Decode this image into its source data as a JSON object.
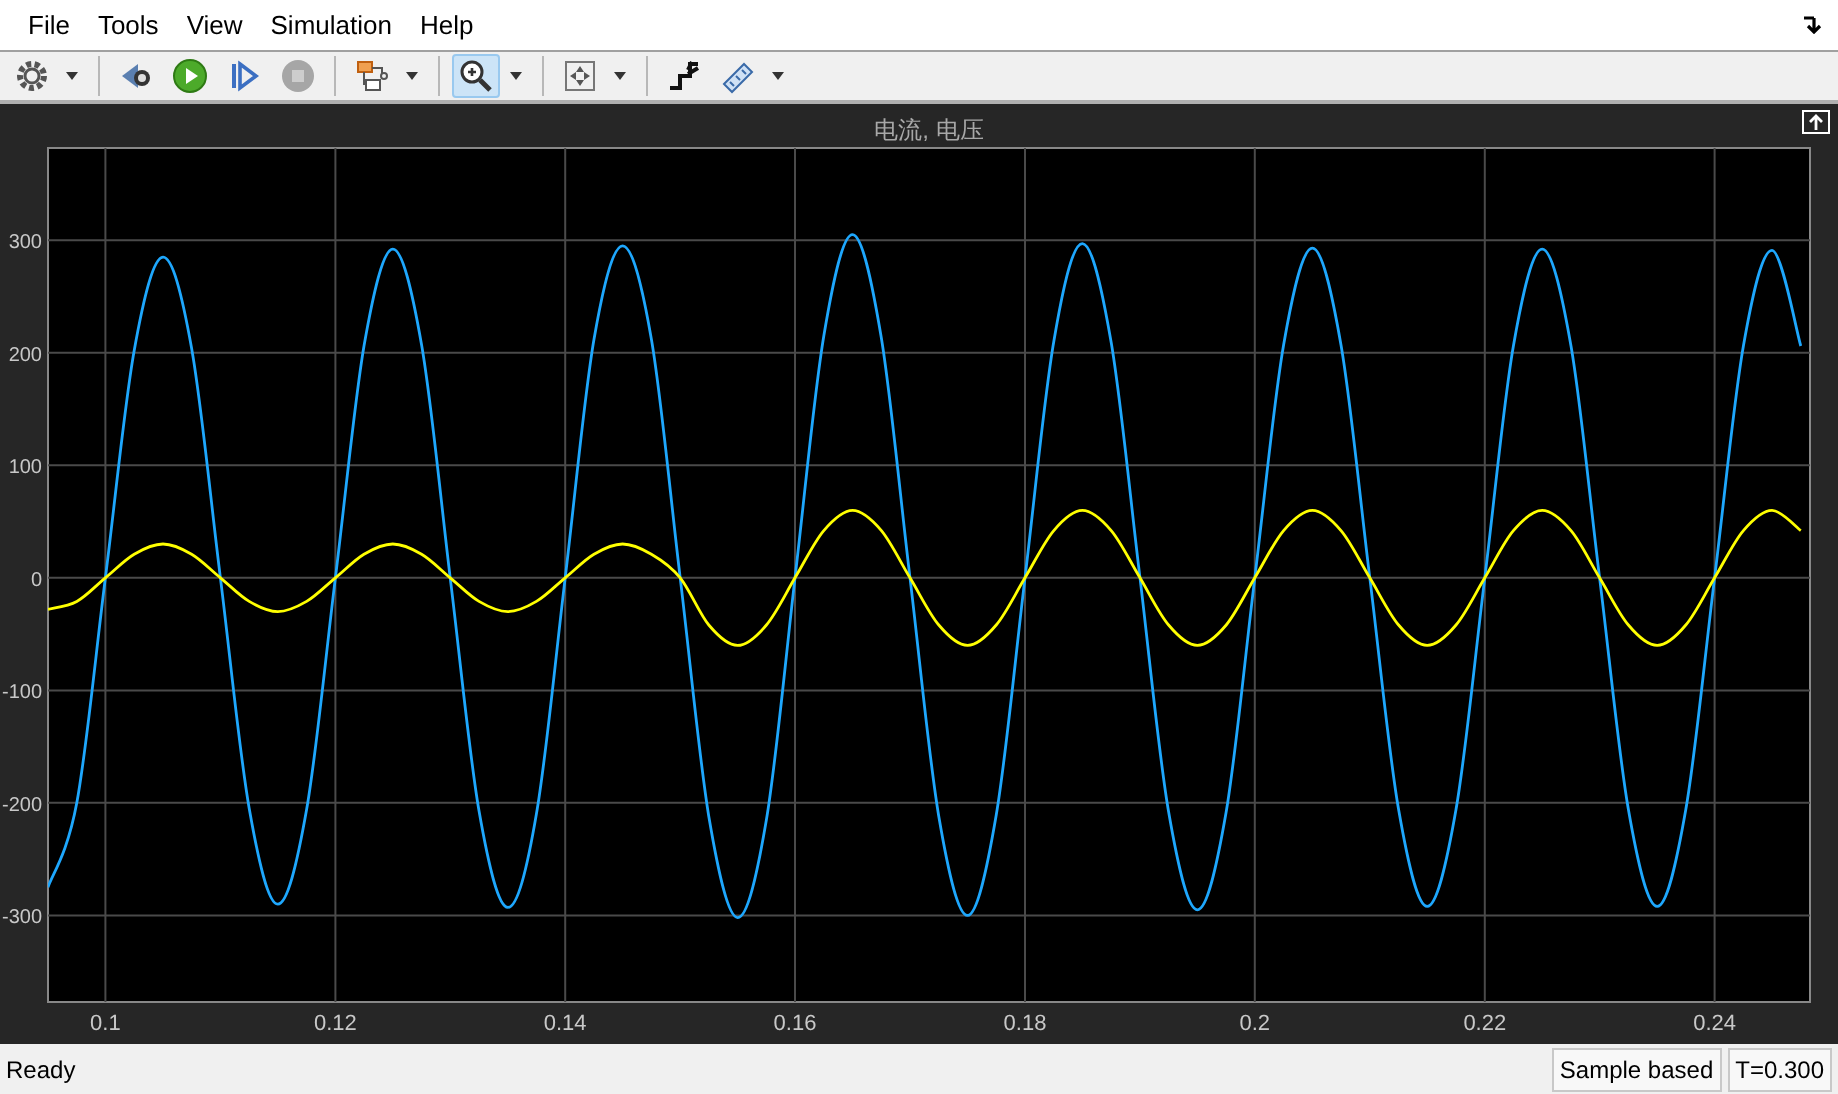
{
  "menu": [
    "File",
    "Tools",
    "View",
    "Simulation",
    "Help"
  ],
  "toolbar": [
    {
      "kind": "settings",
      "dropdown": true,
      "selected": false,
      "disabled": false
    },
    {
      "kind": "separator"
    },
    {
      "kind": "step-back",
      "selected": false,
      "disabled": false
    },
    {
      "kind": "run",
      "selected": false,
      "disabled": false
    },
    {
      "kind": "step-forward",
      "selected": false,
      "disabled": false
    },
    {
      "kind": "stop",
      "selected": false,
      "disabled": true
    },
    {
      "kind": "separator"
    },
    {
      "kind": "highlight",
      "dropdown": true,
      "selected": false,
      "disabled": false
    },
    {
      "kind": "separator"
    },
    {
      "kind": "zoom",
      "dropdown": true,
      "selected": true,
      "disabled": false
    },
    {
      "kind": "separator"
    },
    {
      "kind": "fit",
      "dropdown": true,
      "selected": false,
      "disabled": false
    },
    {
      "kind": "separator"
    },
    {
      "kind": "triggers",
      "selected": false,
      "disabled": false
    },
    {
      "kind": "measure",
      "dropdown": true,
      "selected": false,
      "disabled": false
    }
  ],
  "scope": {
    "chart_data": {
      "type": "line",
      "title": "电流, 电压",
      "x": [
        0.095,
        0.0975,
        0.1,
        0.1025,
        0.105,
        0.1075,
        0.11,
        0.1125,
        0.115,
        0.1175,
        0.12,
        0.1225,
        0.125,
        0.1275,
        0.13,
        0.1325,
        0.135,
        0.1375,
        0.14,
        0.1425,
        0.145,
        0.1475,
        0.15,
        0.1525,
        0.155,
        0.1575,
        0.16,
        0.1625,
        0.165,
        0.1675,
        0.17,
        0.1725,
        0.175,
        0.1775,
        0.18,
        0.1825,
        0.185,
        0.1875,
        0.19,
        0.1925,
        0.195,
        0.1975,
        0.2,
        0.2025,
        0.205,
        0.2075,
        0.21,
        0.2125,
        0.215,
        0.2175,
        0.22,
        0.2225,
        0.225,
        0.2275,
        0.23,
        0.2325,
        0.235,
        0.2375,
        0.24,
        0.2425,
        0.245,
        0.2475
      ],
      "series": [
        {
          "color": "#1ea7fd",
          "values": [
            -275,
            -200,
            0,
            202,
            285,
            204,
            0,
            -205,
            -290,
            -206,
            0,
            206,
            292,
            207,
            0,
            -207,
            -293,
            -210,
            0,
            212,
            295,
            212,
            0,
            -212,
            -302,
            -215,
            0,
            215,
            305,
            213,
            0,
            -212,
            -300,
            -211,
            0,
            210,
            297,
            209,
            0,
            -208,
            -295,
            -208,
            0,
            207,
            293,
            207,
            0,
            -206,
            -292,
            -206,
            0,
            206,
            292,
            206,
            0,
            -206,
            -292,
            -206,
            0,
            206,
            291,
            206
          ]
        },
        {
          "color": "#ffff00",
          "values": [
            -28,
            -21,
            0,
            21,
            30,
            21,
            0,
            -21,
            -30,
            -21,
            0,
            21,
            30,
            21,
            0,
            -21,
            -30,
            -21,
            0,
            21,
            30,
            21,
            0,
            -42,
            -60,
            -42,
            0,
            42,
            60,
            42,
            0,
            -42,
            -60,
            -42,
            0,
            42,
            60,
            42,
            0,
            -42,
            -60,
            -42,
            0,
            42,
            60,
            42,
            0,
            -42,
            -60,
            -42,
            0,
            42,
            60,
            42,
            0,
            -42,
            -60,
            -42,
            0,
            42,
            60,
            42
          ]
        }
      ],
      "xlim": [
        0.095,
        0.2483
      ],
      "ylim": [
        -377,
        382
      ],
      "grid": true,
      "xticks": [
        0.1,
        0.12,
        0.14,
        0.16,
        0.18,
        0.2,
        0.22,
        0.24
      ],
      "yticks": [
        -300,
        -200,
        -100,
        0,
        100,
        200,
        300
      ]
    }
  },
  "status_bar": {
    "message": "Ready",
    "panels": [
      "Sample based",
      "T=0.300"
    ]
  }
}
